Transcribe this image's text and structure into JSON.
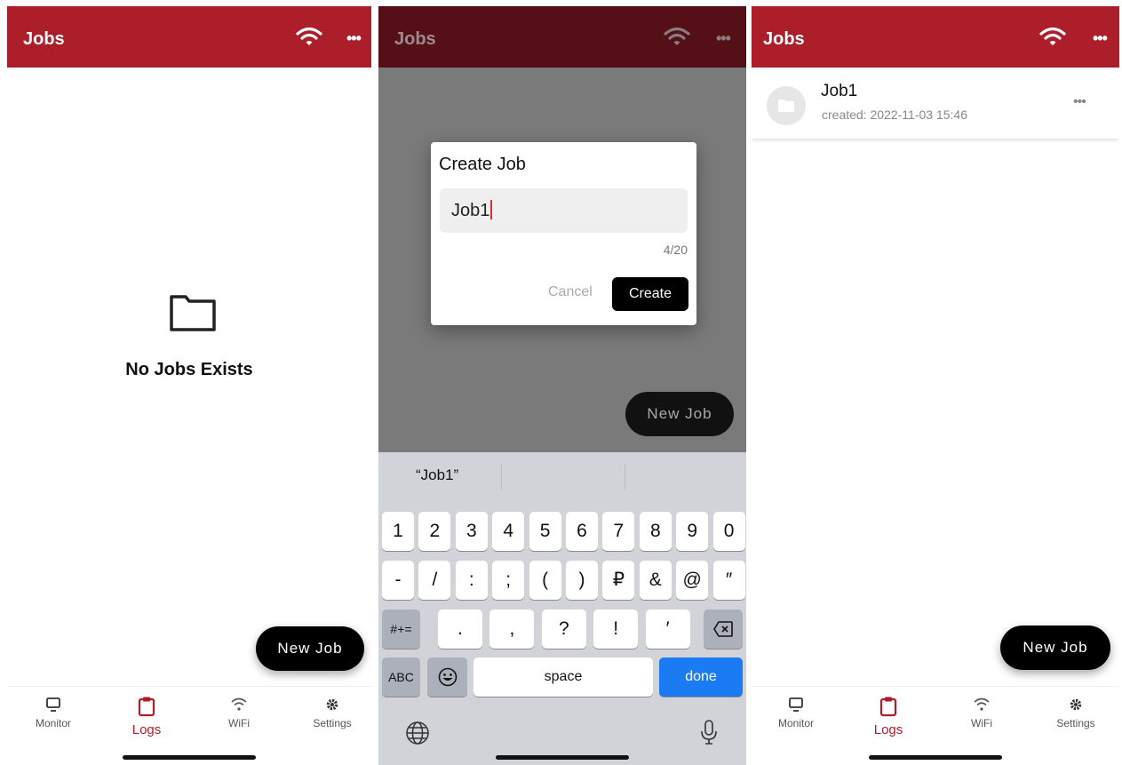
{
  "screens": [
    {
      "header": {
        "title": "Jobs"
      },
      "empty_state": {
        "message": "No Jobs Exists"
      },
      "fab": {
        "label": "New Job"
      },
      "tabs": [
        {
          "label": "Monitor",
          "icon": "monitor-icon"
        },
        {
          "label": "Logs",
          "icon": "clipboard-icon",
          "active": true
        },
        {
          "label": "WiFi",
          "icon": "wifi-icon"
        },
        {
          "label": "Settings",
          "icon": "gear-icon"
        }
      ]
    },
    {
      "header": {
        "title": "Jobs"
      },
      "dialog": {
        "title": "Create Job",
        "input_value": "Job1",
        "counter": "4/20",
        "cancel_label": "Cancel",
        "create_label": "Create"
      },
      "fab": {
        "label": "New Job"
      },
      "keyboard": {
        "suggestion": "“Job1”",
        "row1": [
          "1",
          "2",
          "3",
          "4",
          "5",
          "6",
          "7",
          "8",
          "9",
          "0"
        ],
        "row2": [
          "-",
          "/",
          ":",
          ";",
          "(",
          ")",
          "₽",
          "&",
          "@",
          "″"
        ],
        "row3": [
          ".",
          ",",
          "?",
          "!",
          "′"
        ],
        "symbols_label": "#+=",
        "abc_label": "ABC",
        "space_label": "space",
        "done_label": "done"
      }
    },
    {
      "header": {
        "title": "Jobs"
      },
      "job_list": [
        {
          "name": "Job1",
          "created": "created: 2022-11-03 15:46"
        }
      ],
      "fab": {
        "label": "New Job"
      },
      "tabs": [
        {
          "label": "Monitor",
          "icon": "monitor-icon"
        },
        {
          "label": "Logs",
          "icon": "clipboard-icon",
          "active": true
        },
        {
          "label": "WiFi",
          "icon": "wifi-icon"
        },
        {
          "label": "Settings",
          "icon": "gear-icon"
        }
      ]
    }
  ],
  "colors": {
    "brand": "#ad1e2b",
    "brand_dim": "#541016",
    "primary_button": "#000000",
    "done_key": "#1a7bf2"
  }
}
